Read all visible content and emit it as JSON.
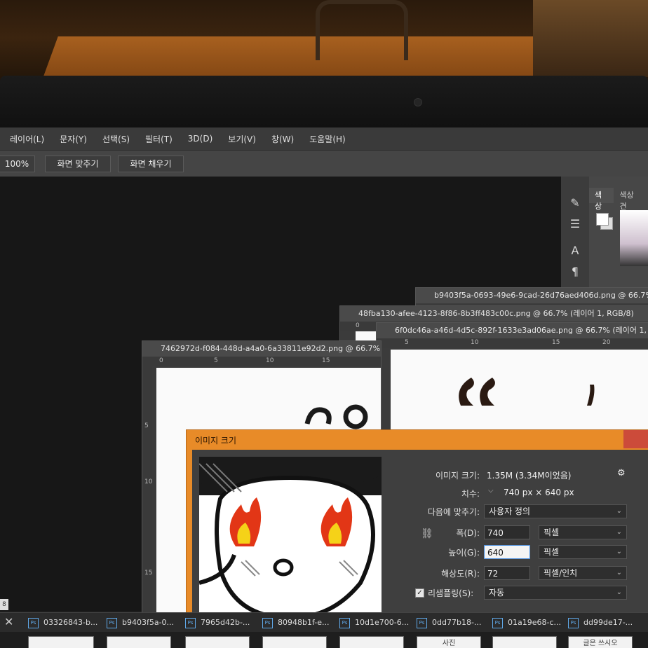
{
  "menu": [
    "레이어(L)",
    "문자(Y)",
    "선택(S)",
    "필터(T)",
    "3D(D)",
    "보기(V)",
    "창(W)",
    "도움말(H)"
  ],
  "options_bar": {
    "zoom": "100%",
    "fit_screen": "화면 맞추기",
    "fill_screen": "화면 채우기"
  },
  "panel_tabs": [
    "색상",
    "색상 견"
  ],
  "documents": [
    {
      "title": "b9403f5a-0693-49e6-9cad-26d76aed406d.png @ 66.7%"
    },
    {
      "title": "48fba130-afee-4123-8f86-8b3ff483c00c.png @ 66.7% (레이어 1, RGB/8)"
    },
    {
      "title": "6f0dc46a-a46d-4d5c-892f-1633e3ad06ae.png @ 66.7% (레이어 1,"
    },
    {
      "title": "7462972d-f084-448d-a4a0-6a33811e92d2.png @ 66.7%"
    }
  ],
  "ruler_ticks": [
    "0",
    "5",
    "10",
    "15",
    "20"
  ],
  "vruler_ticks": [
    "5",
    "10",
    "15"
  ],
  "dialog": {
    "title": "이미지 크기",
    "image_size_label": "이미지 크기:",
    "image_size_value": "1.35M (3.34M이었음)",
    "dimensions_label": "치수:",
    "dimensions_value": "740 px  ×  640 px",
    "fit_to_label": "다음에 맞추기:",
    "fit_to_value": "사용자 정의",
    "width_label": "폭(D):",
    "width_value": "740",
    "width_unit": "픽셀",
    "height_label": "높이(G):",
    "height_value": "640",
    "height_unit": "픽셀",
    "resolution_label": "해상도(R):",
    "resolution_value": "72",
    "resolution_unit": "픽셀/인치",
    "resample_label": "리샘플링(S):",
    "resample_value": "자동"
  },
  "status_ruler": "8",
  "tabs": [
    "03326843-b...",
    "b9403f5a-0...",
    "7965d42b-...",
    "80948b1f-e...",
    "10d1e700-6...",
    "0dd77b18-...",
    "01a19e68-c...",
    "dd99de17-..."
  ],
  "thumb_text": [
    "사진",
    "글은 쓰시오"
  ],
  "colors": {
    "dialog_accent": "#e88b28",
    "close_red": "#cc4b3a",
    "ps_blue": "#5fa8e8"
  }
}
